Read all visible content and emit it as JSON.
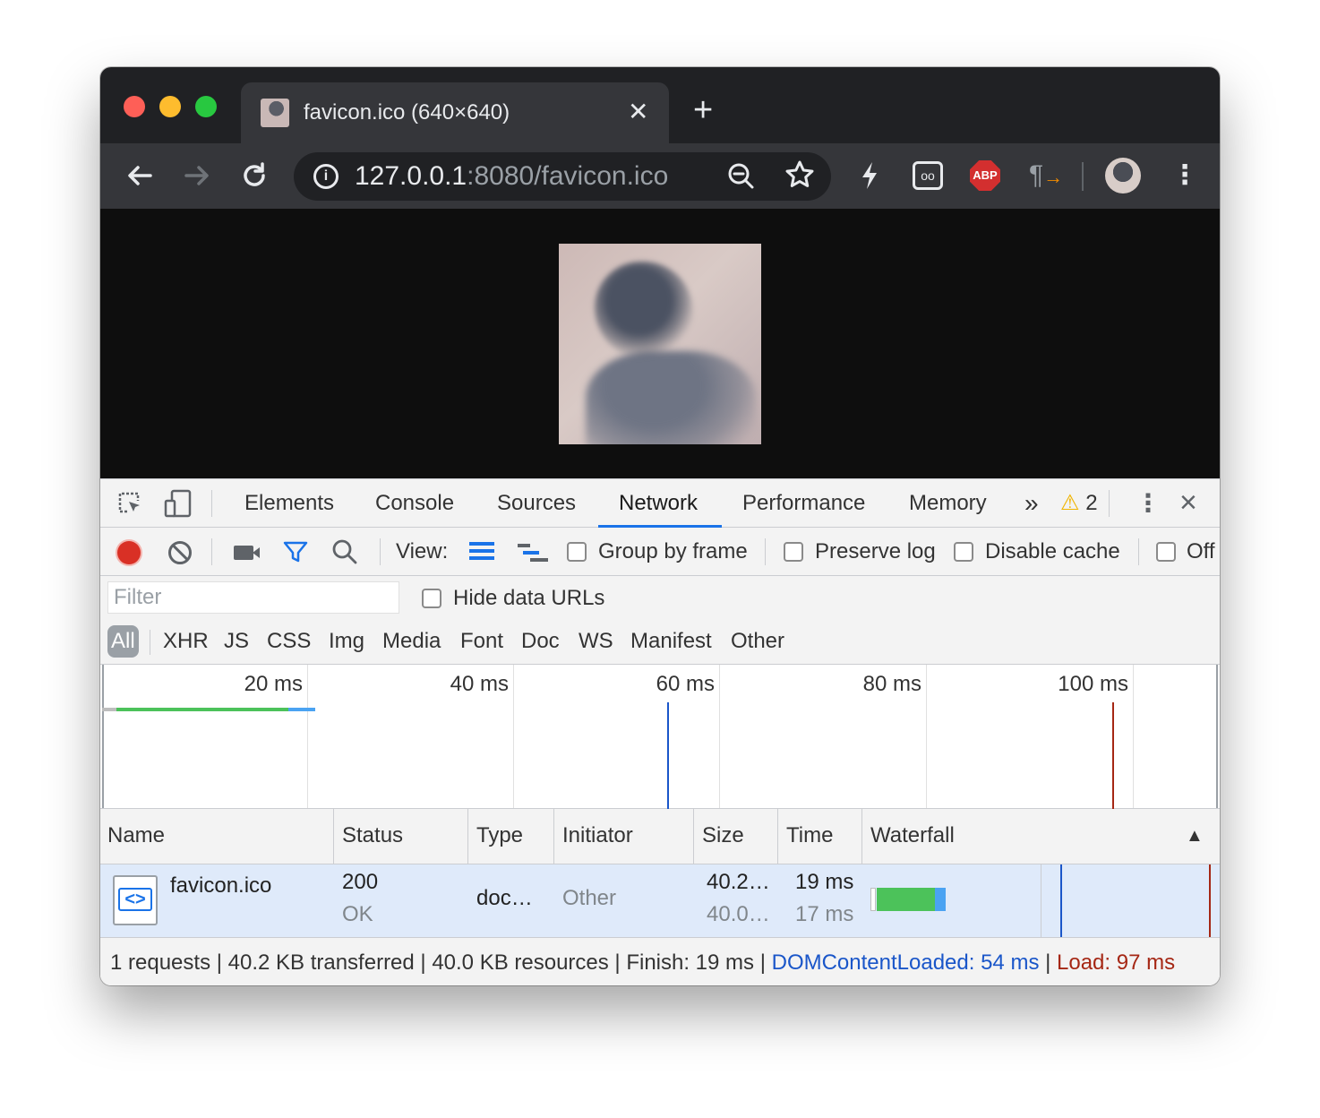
{
  "browser": {
    "tab_title": "favicon.ico (640×640)",
    "tab_close": "✕",
    "new_tab": "+",
    "url_host": "127.0.0.1",
    "url_rest": ":8080/favicon.ico",
    "ext_abp_label": "ABP"
  },
  "devtools": {
    "tabs": [
      "Elements",
      "Console",
      "Sources",
      "Network",
      "Performance",
      "Memory"
    ],
    "active_tab": "Network",
    "more_tabs": "»",
    "warning_count": "2",
    "toolbar": {
      "view_label": "View:",
      "group_by_frame": "Group by frame",
      "preserve_log": "Preserve log",
      "disable_cache": "Disable cache",
      "offline": "Off"
    },
    "filter": {
      "placeholder": "Filter",
      "hide_data_urls": "Hide data URLs"
    },
    "type_filters": [
      "All",
      "XHR",
      "JS",
      "CSS",
      "Img",
      "Media",
      "Font",
      "Doc",
      "WS",
      "Manifest",
      "Other"
    ],
    "active_type": "All",
    "overview": {
      "ticks": [
        "20 ms",
        "40 ms",
        "60 ms",
        "80 ms",
        "100 ms"
      ]
    },
    "table": {
      "headers": [
        "Name",
        "Status",
        "Type",
        "Initiator",
        "Size",
        "Time",
        "Waterfall"
      ],
      "sort_indicator": "▲",
      "rows": [
        {
          "name": "favicon.ico",
          "status_code": "200",
          "status_text": "OK",
          "type": "doc…",
          "initiator": "Other",
          "size_transferred": "40.2…",
          "size_resource": "40.0…",
          "time_total": "19 ms",
          "time_latency": "17 ms"
        }
      ]
    },
    "summary": {
      "main": "1 requests | 40.2 KB transferred | 40.0 KB resources | Finish: 19 ms | ",
      "dcl": "DOMContentLoaded: 54 ms",
      "sep": " | ",
      "load": "Load: 97 ms"
    },
    "colors": {
      "accent": "#1a73e8",
      "record": "#d93025",
      "waiting_bar": "#4cc25a",
      "download_bar": "#4aa3f2",
      "dcl_line": "#1a56c9",
      "load_line": "#a52714"
    }
  }
}
